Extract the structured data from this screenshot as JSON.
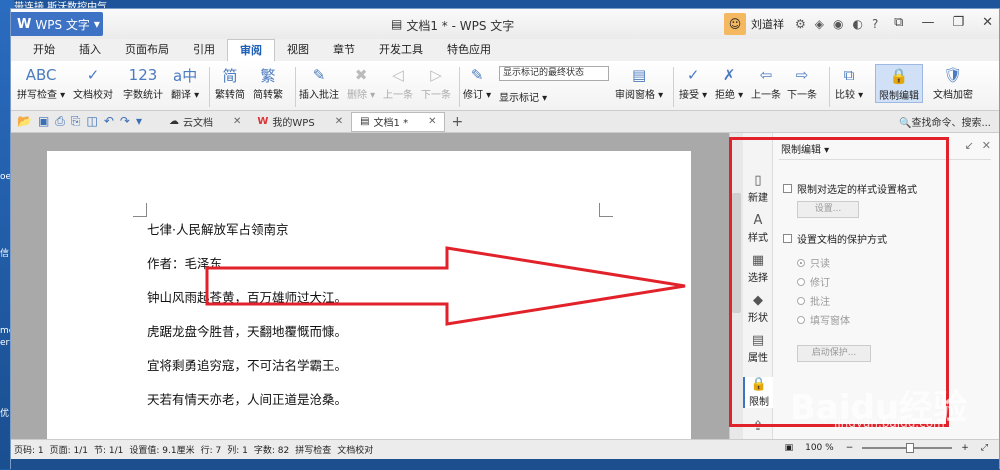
{
  "desktop": {
    "top_text": "带连接  斯沃数控中气",
    "left_labels": [
      "oe",
      "信",
      "me",
      "ert",
      "优"
    ]
  },
  "app": {
    "name": "WPS 文字",
    "window_title": "文档1 * - WPS 文字",
    "user": "刘道祥",
    "window_controls": [
      "⧉",
      "—",
      "❐",
      "✕"
    ]
  },
  "menu_tabs": [
    "开始",
    "插入",
    "页面布局",
    "引用",
    "审阅",
    "视图",
    "章节",
    "开发工具",
    "特色应用"
  ],
  "active_tab": "审阅",
  "ribbon": {
    "buttons": [
      {
        "label": "拼写检查 ▾",
        "icon": "ABC"
      },
      {
        "label": "文档校对",
        "icon": "✓"
      },
      {
        "label": "字数统计",
        "icon": "123"
      },
      {
        "label": "翻译 ▾",
        "icon": "a中"
      },
      {
        "label": "繁转简",
        "icon": "简"
      },
      {
        "label": "简转繁",
        "icon": "繁"
      },
      {
        "label": "插入批注",
        "icon": "✎"
      },
      {
        "label": "删除 ▾",
        "icon": "✖"
      },
      {
        "label": "上一条",
        "icon": "◁"
      },
      {
        "label": "下一条",
        "icon": "▷"
      },
      {
        "label": "修订 ▾",
        "icon": "✎"
      },
      {
        "label": "审阅窗格 ▾",
        "icon": "▤"
      },
      {
        "label": "接受 ▾",
        "icon": "✓"
      },
      {
        "label": "拒绝 ▾",
        "icon": "✗"
      },
      {
        "label": "上一条",
        "icon": "⇦"
      },
      {
        "label": "下一条",
        "icon": "⇨"
      },
      {
        "label": "比较 ▾",
        "icon": "⧉"
      },
      {
        "label": "限制编辑",
        "icon": "🔒"
      },
      {
        "label": "文档加密",
        "icon": "🛡"
      }
    ],
    "state_select": "显示标记的最终状态",
    "show_markup": "显示标记 ▾"
  },
  "quickbar": {
    "tabs": [
      {
        "label": "云文档",
        "icon": "☁"
      },
      {
        "label": "我的WPS",
        "icon": "W"
      },
      {
        "label": "文档1 *",
        "icon": "▤"
      }
    ],
    "search": "查找命令、搜索..."
  },
  "document": {
    "lines": [
      "七律·人民解放军占领南京",
      "作者：毛泽东",
      "钟山风雨起苍黄，百万雄师过大江。",
      "虎踞龙盘今胜昔，天翻地覆慨而慷。",
      "宜将剩勇追穷寇，不可沽名学霸王。",
      "天若有情天亦老，人间正道是沧桑。"
    ]
  },
  "sidebar": [
    {
      "label": "新建",
      "icon": "▯"
    },
    {
      "label": "样式",
      "icon": "A"
    },
    {
      "label": "选择",
      "icon": "▦"
    },
    {
      "label": "形状",
      "icon": "◆"
    },
    {
      "label": "属性",
      "icon": "▤"
    },
    {
      "label": "限制",
      "icon": "🔒"
    },
    {
      "label": "分享",
      "icon": "⇪"
    }
  ],
  "panel": {
    "title": "限制编辑 ▾",
    "chk1": "限制对选定的样式设置格式",
    "btn_settings": "设置...",
    "chk2": "设置文档的保护方式",
    "radios": [
      "只读",
      "修订",
      "批注",
      "填写窗体"
    ],
    "btn_start": "启动保护..."
  },
  "status": {
    "items": [
      "页码: 1",
      "页面: 1/1",
      "节: 1/1",
      "设置值: 9.1厘米",
      "行: 7",
      "列: 1",
      "字数: 82",
      "拼写检查",
      "文档校对"
    ],
    "zoom": "100 %"
  },
  "watermark": {
    "text": "Baidu经验",
    "sub": "jingyan.baidu.com"
  },
  "colors": {
    "accent": "#3d72c4",
    "highlight": "#e2222a"
  }
}
